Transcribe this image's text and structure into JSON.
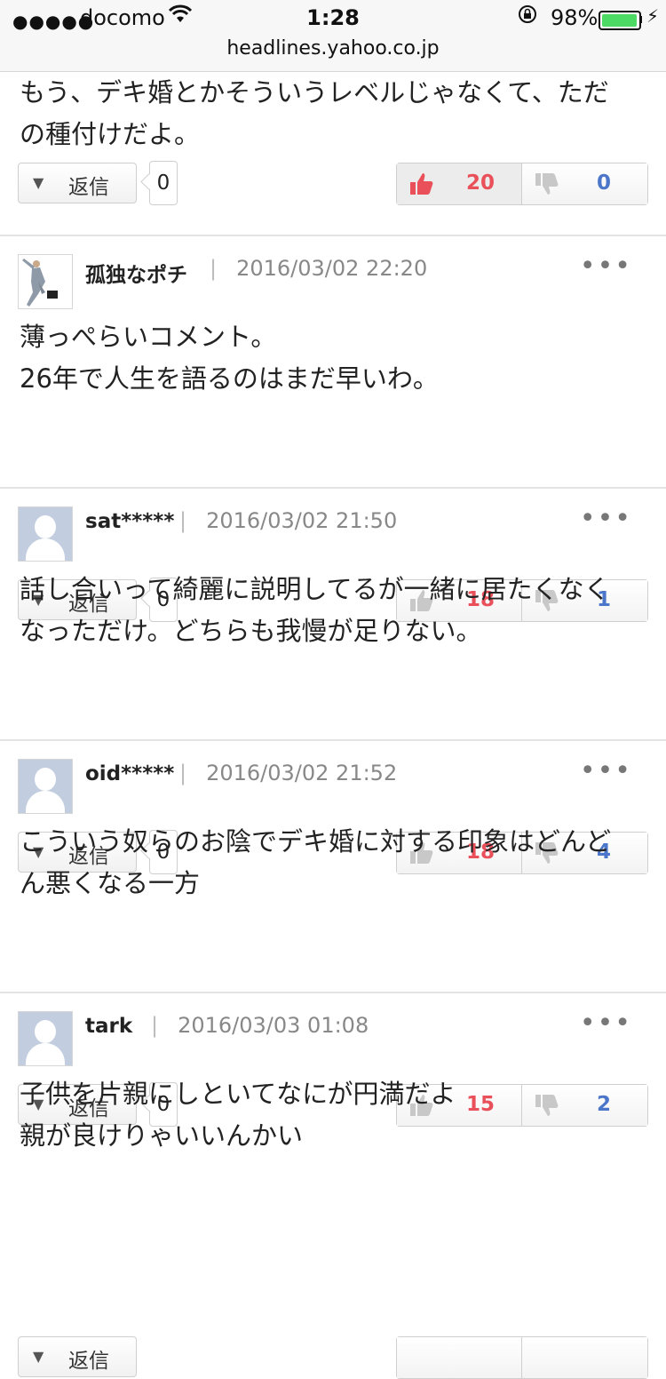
{
  "status_bar": {
    "carrier": "docomo",
    "time": "1:28",
    "battery_percent": "98%",
    "battery_level": 0.98,
    "url": "headlines.yahoo.co.jp"
  },
  "reply_label": "返信",
  "comments": [
    {
      "text": "もう、デキ婚とかそういうレベルじゃなくて、ただ\nの種付けだよ。",
      "reply_count": "0",
      "likes": "20",
      "dislikes": "0"
    },
    {
      "user": "孤独なポチ",
      "date": "2016/03/02 22:20",
      "text": "薄っぺらいコメント。\n26年で人生を語るのはまだ早いわ。",
      "reply_count": "0",
      "likes": "18",
      "dislikes": "1"
    },
    {
      "user": "sat*****",
      "date": "2016/03/02 21:50",
      "text": "話し合いって綺麗に説明してるが一緒に居たくなく\nなっただけ。どちらも我慢が足りない。",
      "reply_count": "0",
      "likes": "18",
      "dislikes": "4"
    },
    {
      "user": "oid*****",
      "date": "2016/03/02 21:52",
      "text": "こういう奴らのお陰でデキ婚に対する印象はどんど\nん悪くなる一方",
      "reply_count": "0",
      "likes": "15",
      "dislikes": "2"
    },
    {
      "user": "tark",
      "date": "2016/03/03 01:08",
      "text": "子供を片親にしといてなにが円満だよ\n親が良けりゃいいんかい",
      "reply_count": "",
      "likes": "",
      "dislikes": ""
    }
  ]
}
